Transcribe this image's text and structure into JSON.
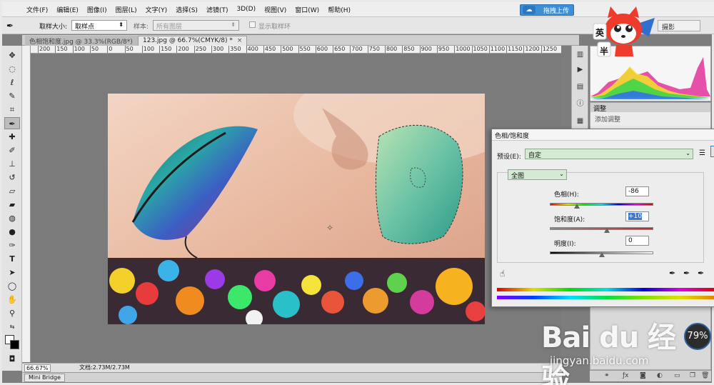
{
  "menu": {
    "items": [
      "文件(F)",
      "编辑(E)",
      "图像(I)",
      "图层(L)",
      "文字(Y)",
      "选择(S)",
      "滤镜(T)",
      "3D(D)",
      "视图(V)",
      "窗口(W)",
      "帮助(H)"
    ],
    "upload_button": "拖拽上传"
  },
  "options": {
    "sample_size_label": "取样大小:",
    "sample_size_value": "取样点",
    "sample_label": "样本:",
    "sample_value": "所有图层",
    "show_ring_label": "显示取样环",
    "workspace": "摄影"
  },
  "tabs": [
    {
      "label": "色相饱和度.jpg @ 33.3%(RGB/8*)",
      "close": "×"
    },
    {
      "label": "123.jpg @ 66.7%(CMYK/8) *",
      "close": "×"
    }
  ],
  "ruler_ticks": [
    "200",
    "150",
    "100",
    "50",
    "0",
    "50",
    "100",
    "150",
    "200",
    "250",
    "300",
    "350",
    "400",
    "450",
    "500",
    "550",
    "600",
    "650",
    "700",
    "750",
    "800",
    "850",
    "900",
    "950",
    "1000",
    "1050",
    "1100",
    "1150",
    "1200",
    "1250"
  ],
  "status": {
    "zoom": "66.67%",
    "doc": "文档:2.73M/2.73M"
  },
  "mini_bridge": "Mini Bridge",
  "adjustments": {
    "title": "调整",
    "subtitle": "添加调整"
  },
  "hue_sat": {
    "title": "色相/饱和度",
    "preset_label": "预设(E):",
    "preset_value": "自定",
    "channel": "全图",
    "hue_label": "色相(H):",
    "hue_value": "-86",
    "hue_slider": -86,
    "saturation_label": "饱和度(A):",
    "saturation_value": "+10",
    "saturation_slider": 10,
    "lightness_label": "明度(I):",
    "lightness_value": "0",
    "lightness_slider": 0
  },
  "mascot_text": [
    "英",
    "半"
  ],
  "badge": "79%",
  "watermark": {
    "main": "Bai du 经验",
    "url": "jingyan.baidu.com"
  },
  "colors": {
    "accent": "#3f8fd6",
    "selection_highlight": "#3a78d4",
    "preset_bg": "#d5ead4"
  }
}
